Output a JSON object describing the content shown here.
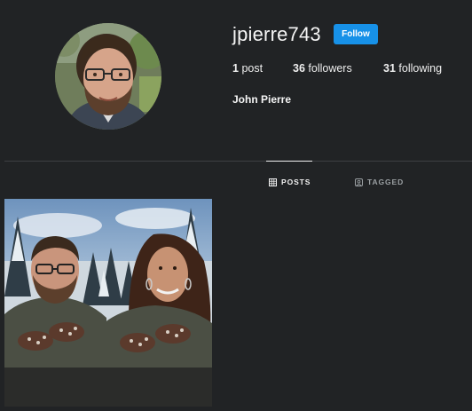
{
  "profile": {
    "username": "jpierre743",
    "follow_label": "Follow",
    "full_name": "John Pierre",
    "stats": {
      "posts_count": "1",
      "posts_label": "post",
      "followers_count": "36",
      "followers_label": "followers",
      "following_count": "31",
      "following_label": "following"
    }
  },
  "tabs": [
    {
      "label": "POSTS",
      "icon": "grid-icon",
      "active": true
    },
    {
      "label": "TAGGED",
      "icon": "tag-person-icon",
      "active": false
    }
  ],
  "colors": {
    "background": "#212325",
    "accent": "#1791e8",
    "divider": "#3d4043",
    "inactive_tab": "#9ba0a3"
  }
}
